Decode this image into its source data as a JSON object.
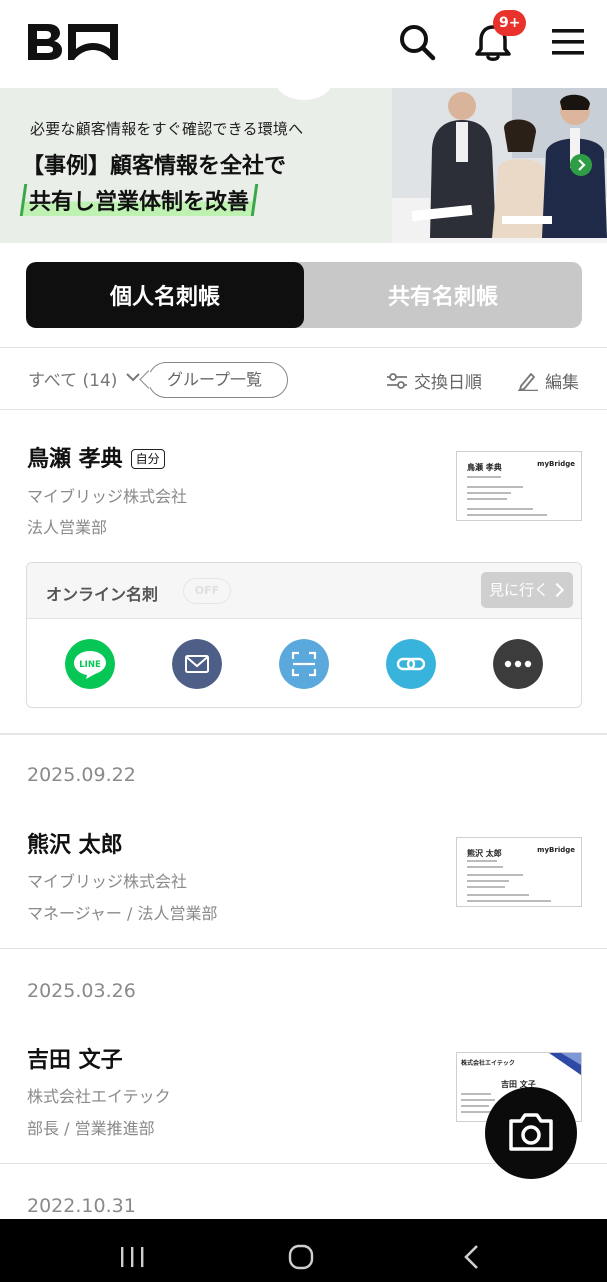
{
  "header": {
    "logo_alt": "B",
    "notification_badge": "9+",
    "icons": [
      "search-icon",
      "bell-icon",
      "hamburger-menu-icon"
    ]
  },
  "banner": {
    "subtitle": "必要な顧客情報をすぐ確認できる環境へ",
    "line1": "【事例】顧客情報を全社で",
    "line2": "共有し営業体制を改善"
  },
  "tabs": {
    "personal": "個人名刺帳",
    "shared": "共有名刺帳",
    "active": "personal"
  },
  "toolbar": {
    "filter_label": "すべて (14)",
    "group_list": "グループ一覧",
    "sort_label": "交換日順",
    "edit_label": "編集"
  },
  "my_card": {
    "name": "鳥瀬 孝典",
    "self_badge": "自分",
    "company": "マイブリッジ株式会社",
    "department": "法人営業部",
    "thumb_name": "鳥瀬 孝典",
    "thumb_brand": "myBridge",
    "online_title": "オンライン名刺",
    "online_status": "OFF",
    "goto_label": "見に行く",
    "actions": [
      "line-icon",
      "mail-icon",
      "scan-icon",
      "link-icon",
      "more-icon"
    ],
    "line_label": "LINE"
  },
  "contacts": [
    {
      "date": "2025.09.22",
      "name": "熊沢 太郎",
      "company": "マイブリッジ株式会社",
      "role": "マネージャー / 法人営業部",
      "thumb_name": "熊沢 太郎",
      "thumb_brand": "myBridge"
    },
    {
      "date": "2025.03.26",
      "name": "吉田 文子",
      "company": "株式会社エイテック",
      "role": "部長 / 営業推進部",
      "thumb_name": "吉田 文子",
      "thumb_brand": "株式会社エイテック"
    },
    {
      "date": "2022.10.31"
    }
  ],
  "fab": {
    "icon": "camera-icon"
  },
  "system_nav": [
    "recent-apps-icon",
    "home-icon",
    "back-icon"
  ],
  "colors": {
    "accent_dark": "#0f0f0f",
    "badge_red": "#e8322b",
    "line_green": "#06c755",
    "mail_blue": "#4d5f86",
    "scan_blue": "#5aa8dc",
    "link_blue": "#37b3dc",
    "more_gray": "#3c3c3c"
  }
}
